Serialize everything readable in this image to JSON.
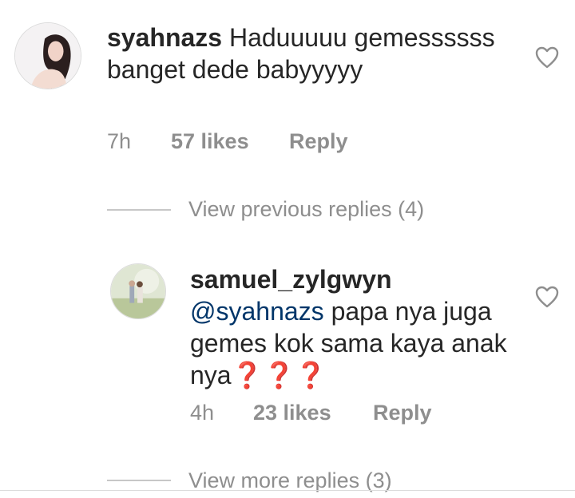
{
  "comments": [
    {
      "username": "syahnazs",
      "text": " Haduuuuu gemessssss banget dede babyyyyy",
      "time": "7h",
      "likes": "57 likes",
      "reply": "Reply",
      "heart_icon": "heart-outline-icon"
    }
  ],
  "replies_prev": "View previous replies (4)",
  "reply": {
    "username": "samuel_zylgwyn",
    "mention": "@syahnazs",
    "text": " papa nya juga gemes kok sama kaya anak nya❓❓❓",
    "time": "4h",
    "likes": "23 likes",
    "reply": "Reply",
    "heart_icon": "heart-outline-icon"
  },
  "replies_more": "View more replies (3)",
  "colors": {
    "text": "#262626",
    "muted": "#8e8e8e",
    "mention": "#003569",
    "divider": "#c7c7c7"
  }
}
